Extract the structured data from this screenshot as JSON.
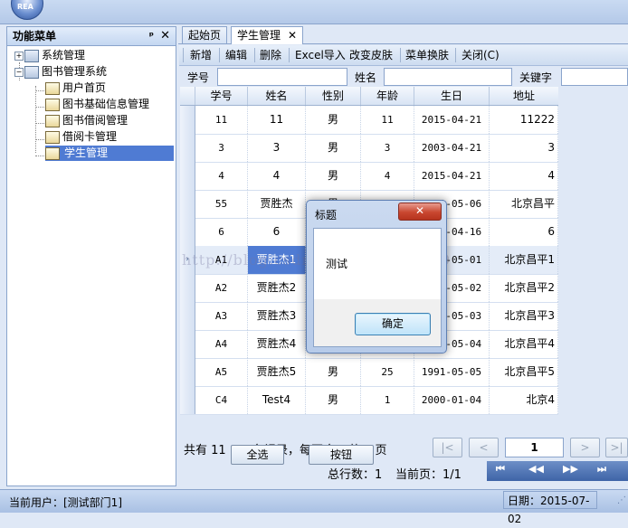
{
  "logo": {
    "text": "REA"
  },
  "left_panel": {
    "title": "功能菜单",
    "pin_icon": "ᵖ",
    "close_icon": "✕",
    "tree": [
      {
        "label": "系统管理",
        "expander": "+"
      },
      {
        "label": "图书管理系统",
        "expander": "−"
      },
      {
        "label": "用户首页"
      },
      {
        "label": "图书基础信息管理"
      },
      {
        "label": "图书借阅管理"
      },
      {
        "label": "借阅卡管理"
      },
      {
        "label": "学生管理"
      }
    ]
  },
  "tabs": [
    {
      "label": "起始页"
    },
    {
      "label": "学生管理",
      "close": "✕"
    }
  ],
  "toolbar": {
    "items": [
      "新增",
      "编辑",
      "删除",
      "Excel导入",
      "改变皮肤",
      "菜单换肤",
      "关闭(C)"
    ]
  },
  "search": {
    "labels": [
      "学号",
      "姓名",
      "关键字"
    ]
  },
  "grid": {
    "columns": [
      "学号",
      "姓名",
      "性别",
      "年龄",
      "生日",
      "地址"
    ],
    "rows": [
      [
        "11",
        "11",
        "男",
        "11",
        "2015-04-21",
        "11222"
      ],
      [
        "3",
        "3",
        "男",
        "3",
        "2003-04-21",
        "3"
      ],
      [
        "4",
        "4",
        "男",
        "4",
        "2015-04-21",
        "4"
      ],
      [
        "55",
        "贾胜杰",
        "男",
        "",
        "1991-05-06",
        "北京昌平"
      ],
      [
        "6",
        "6",
        "",
        "",
        "2015-04-16",
        "6"
      ],
      [
        "A1",
        "贾胜杰1",
        "",
        "",
        "2015-05-01",
        "北京昌平1"
      ],
      [
        "A2",
        "贾胜杰2",
        "",
        "",
        "1991-05-02",
        "北京昌平2"
      ],
      [
        "A3",
        "贾胜杰3",
        "",
        "",
        "1991-05-03",
        "北京昌平3"
      ],
      [
        "A4",
        "贾胜杰4",
        "",
        "",
        "1991-05-04",
        "北京昌平4"
      ],
      [
        "A5",
        "贾胜杰5",
        "男",
        "25",
        "1991-05-05",
        "北京昌平5"
      ],
      [
        "C4",
        "Test4",
        "男",
        "1",
        "2000-01-04",
        "北京4"
      ]
    ],
    "row_indicator": "›"
  },
  "watermark": "http://blog.csdn.net/u013816709",
  "pager": {
    "summary_parts": [
      "共有 11",
      "条记录，每页",
      "条，共 1 页"
    ],
    "select_all": "全选",
    "invert": "按钮",
    "total_rows": "总行数：1",
    "current_page": "当前页：1/1",
    "page_value": "1",
    "nav_first": "|<",
    "nav_prev": "<",
    "nav_next": ">",
    "nav_last": ">|",
    "nav2": [
      "⏮",
      "◀◀",
      "▶▶",
      "⏭"
    ]
  },
  "status": {
    "user": "当前用户：[测试部门1]",
    "date": "日期：2015-07-02"
  },
  "dialog": {
    "title": "标题",
    "close": "✕",
    "message": "测试",
    "ok": "确定"
  }
}
